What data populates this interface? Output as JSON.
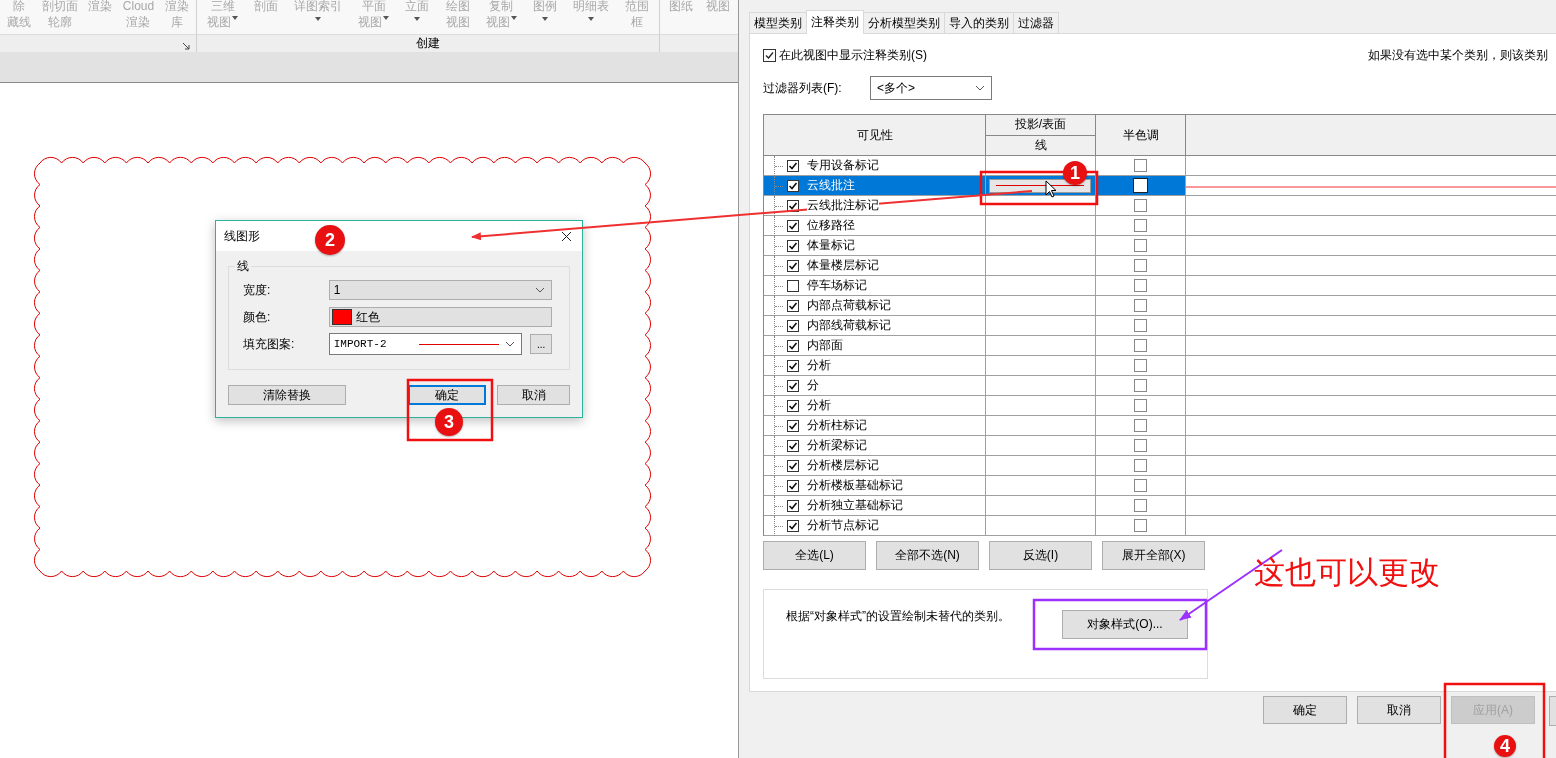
{
  "ribbon": {
    "groups": [
      {
        "launcher": true,
        "items": [
          {
            "lines": [
              "除",
              "藏线"
            ]
          },
          {
            "lines": [
              "剖切面",
              "轮廓"
            ]
          },
          {
            "lines": [
              "渲染"
            ]
          },
          {
            "lines": [
              "Cloud",
              "渲染"
            ]
          },
          {
            "lines": [
              "渲染",
              "库"
            ]
          }
        ]
      },
      {
        "label": "创建",
        "items": [
          {
            "lines": [
              "三维",
              "视图"
            ],
            "dropdown": true
          },
          {
            "lines": [
              "剖面"
            ]
          },
          {
            "lines": [
              "详图索引"
            ],
            "dropdown": true
          },
          {
            "lines": [
              "平面",
              "视图"
            ],
            "dropdown": true
          },
          {
            "lines": [
              "立面"
            ],
            "dropdown": true
          },
          {
            "lines": [
              "绘图",
              "视图"
            ]
          },
          {
            "lines": [
              "复制",
              "视图"
            ],
            "dropdown": true
          },
          {
            "lines": [
              "图例"
            ],
            "dropdown": true
          },
          {
            "lines": [
              "明细表"
            ],
            "dropdown": true
          },
          {
            "lines": [
              "范围",
              "框"
            ]
          }
        ]
      },
      {
        "items": [
          {
            "lines": [
              "图纸"
            ]
          },
          {
            "lines": [
              "视图"
            ]
          }
        ]
      }
    ]
  },
  "line_dialog": {
    "title": "线图形",
    "group": "线",
    "fields": [
      {
        "kind": "dropdown",
        "label": "宽度:",
        "value": "1"
      },
      {
        "kind": "color",
        "label": "颜色:",
        "value": "红色"
      },
      {
        "kind": "pattern",
        "label": "填充图案:",
        "value": "IMPORT-2",
        "more": "..."
      }
    ],
    "buttons": [
      {
        "label": "清除替换",
        "default": false
      },
      {
        "label": "确定",
        "default": true
      },
      {
        "label": "取消",
        "default": false
      }
    ]
  },
  "vg_dialog": {
    "tabs": [
      {
        "label": "模型类别",
        "selected": false
      },
      {
        "label": "注释类别",
        "selected": true
      },
      {
        "label": "分析模型类别",
        "selected": false
      },
      {
        "label": "导入的类别",
        "selected": false
      },
      {
        "label": "过滤器",
        "selected": false
      }
    ],
    "show_categories": {
      "label": "在此视图中显示注释类别(S)",
      "checked": true
    },
    "note": "如果没有选中某个类别，则该类别",
    "filter": {
      "label": "过滤器列表(F):",
      "value": "<多个>"
    },
    "table": {
      "columns": {
        "visibility": "可见性",
        "projection": "投影/表面",
        "line": "线",
        "halftone": "半色调"
      },
      "rows": [
        {
          "name": "专用设备标记",
          "visible": true,
          "halftone": false,
          "override": false,
          "selected": false
        },
        {
          "name": "云线批注",
          "visible": true,
          "halftone": false,
          "override": true,
          "selected": true
        },
        {
          "name": "云线批注标记",
          "visible": true,
          "halftone": false,
          "override": false,
          "selected": false
        },
        {
          "name": "位移路径",
          "visible": true,
          "halftone": false,
          "override": false,
          "selected": false
        },
        {
          "name": "体量标记",
          "visible": true,
          "halftone": false,
          "override": false,
          "selected": false
        },
        {
          "name": "体量楼层标记",
          "visible": true,
          "halftone": false,
          "override": false,
          "selected": false
        },
        {
          "name": "停车场标记",
          "visible": false,
          "halftone": false,
          "override": false,
          "selected": false
        },
        {
          "name": "内部点荷载标记",
          "visible": true,
          "halftone": false,
          "override": false,
          "selected": false
        },
        {
          "name": "内部线荷载标记",
          "visible": true,
          "halftone": false,
          "override": false,
          "selected": false
        },
        {
          "name": "内部面",
          "visible": true,
          "halftone": false,
          "override": false,
          "selected": false
        },
        {
          "name": "分析",
          "visible": true,
          "halftone": false,
          "override": false,
          "selected": false
        },
        {
          "name": "分",
          "visible": true,
          "halftone": false,
          "override": false,
          "selected": false
        },
        {
          "name": "分析",
          "visible": true,
          "halftone": false,
          "override": false,
          "selected": false
        },
        {
          "name": "分析柱标记",
          "visible": true,
          "halftone": false,
          "override": false,
          "selected": false
        },
        {
          "name": "分析梁标记",
          "visible": true,
          "halftone": false,
          "override": false,
          "selected": false
        },
        {
          "name": "分析楼层标记",
          "visible": true,
          "halftone": false,
          "override": false,
          "selected": false
        },
        {
          "name": "分析楼板基础标记",
          "visible": true,
          "halftone": false,
          "override": false,
          "selected": false
        },
        {
          "name": "分析独立基础标记",
          "visible": true,
          "halftone": false,
          "override": false,
          "selected": false
        },
        {
          "name": "分析节点标记",
          "visible": true,
          "halftone": false,
          "override": false,
          "selected": false
        }
      ]
    },
    "list_buttons": [
      "全选(L)",
      "全部不选(N)",
      "反选(I)",
      "展开全部(X)"
    ],
    "object_styles": {
      "text": "根据“对象样式”的设置绘制未替代的类别。",
      "button": "对象样式(O)..."
    },
    "footer_buttons": [
      {
        "label": "确定",
        "disabled": false
      },
      {
        "label": "取消",
        "disabled": false
      },
      {
        "label": "应用(A)",
        "disabled": true
      }
    ]
  },
  "annotations": {
    "markers": [
      "1",
      "2",
      "3",
      "4"
    ],
    "note": "这也可以更改"
  }
}
